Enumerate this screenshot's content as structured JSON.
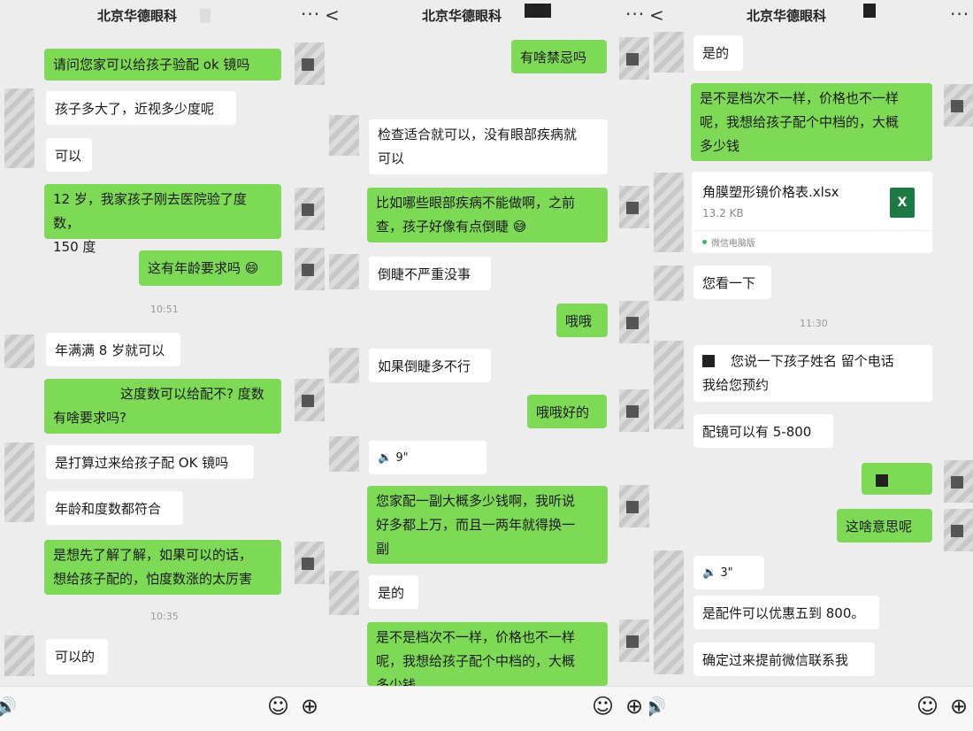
{
  "title": "北京华德眼科",
  "left": {
    "m1": "请问您家可以给孩子验配 ok 镜吗",
    "m2": "孩子多大了，近视多少度呢",
    "m3": "可以",
    "m4a": "12 岁，我家孩子刚去医院验了度数，",
    "m4b": "150 度",
    "m5": "这有年龄要求吗",
    "t1": "10:51",
    "m6": "年满满 8 岁就可以",
    "m7a": "这度数可以给配不? 度数",
    "m7b": "有啥要求吗?",
    "m8": "是打算过来给孩子配 OK 镜吗",
    "m9": "年龄和度数都符合",
    "m10a": "是想先了解了解，如果可以的话，",
    "m10b": "想给孩子配的，怕度数涨的太厉害",
    "t2": "10:35",
    "m11": "可以的"
  },
  "middle": {
    "m1": "有啥禁忌吗",
    "m2a": "检查适合就可以，没有眼部疾病就",
    "m2b": "可以",
    "m3a": "比如哪些眼部疾病不能做啊，之前",
    "m3b": "查，孩子好像有点倒睫",
    "m4": "倒睫不严重没事",
    "m5": "哦哦",
    "m6": "如果倒睫多不行",
    "m7": "哦哦好的",
    "m8": "9\"",
    "m9a": "您家配一副大概多少钱啊，我听说",
    "m9b": "好多都上万，而且一两年就得换一",
    "m9c": "副",
    "m10": "是的",
    "m11a": "是不是档次不一样，价格也不一样",
    "m11b": "呢，我想给孩子配个中档的，大概",
    "m11c": "多少钱"
  },
  "right": {
    "m1": "是的",
    "m2a": "是不是档次不一样，价格也不一样",
    "m2b": "呢，我想给孩子配个中档的，大概",
    "m2c": "多少钱",
    "file_name": "角膜塑形镜价格表.xlsx",
    "file_size": "13.2 KB",
    "file_src": "微信电脑版",
    "file_icon": "X",
    "m3": "您看一下",
    "t1": "11:30",
    "m4a": "您说一下孩子姓名  留个电话",
    "m4b": "我给您预约",
    "m5": "配镜可以有 5-800",
    "m6": "这啥意思呢",
    "m7": "3\"",
    "m8": "是配件可以优惠五到 800。",
    "m9": "确定过来提前微信联系我"
  },
  "icons": {
    "back": "<",
    "more": "···",
    "voice": "🔊",
    "emoji": "☺",
    "plus": "⊕"
  }
}
